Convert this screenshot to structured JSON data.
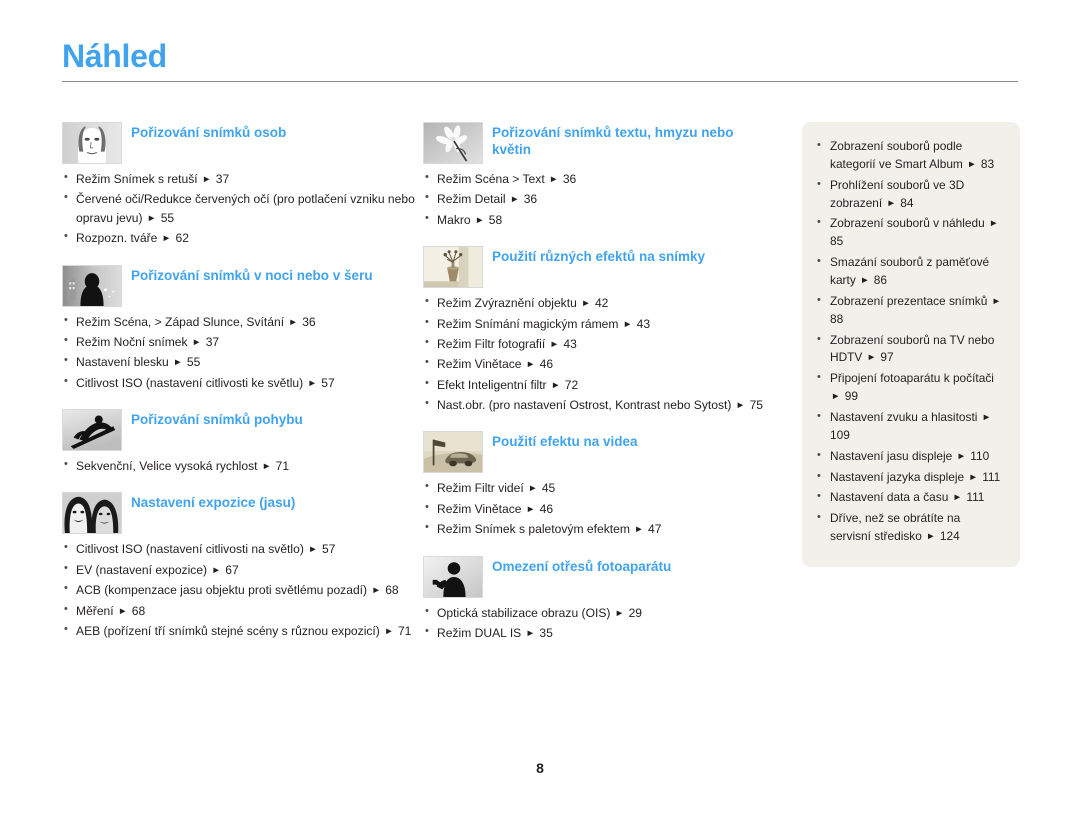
{
  "header": {
    "title": "Náhled"
  },
  "footer": {
    "page_number": "8"
  },
  "colors": {
    "accent": "#41a3ed",
    "text": "#231f20",
    "panel_bg": "#f2f0eb",
    "rule": "#8b8b8b"
  },
  "arrow_glyph": "►",
  "columns": {
    "left": [
      {
        "icon": "portrait-face-icon",
        "title": "Pořizování snímků osob",
        "items": [
          "Režim Snímek s retuší ► 37",
          "Červené oči/Redukce červených očí (pro potlačení vzniku nebo opravu jevu) ► 55",
          "Rozpozn. tváře ► 62"
        ]
      },
      {
        "icon": "night-silhouette-moon-icon",
        "title": "Pořizování snímků v noci nebo v šeru",
        "items": [
          "Režim Scéna, > Západ Slunce, Svítání ► 36",
          "Režim Noční snímek ► 37",
          "Nastavení blesku ► 55",
          "Citlivost ISO (nastavení citlivosti ke světlu) ► 57"
        ]
      },
      {
        "icon": "snowboarder-motion-icon",
        "title": "Pořizování snímků pohybu",
        "items": [
          "Sekvenční, Velice vysoká rychlost ► 71"
        ]
      },
      {
        "icon": "two-faces-exposure-icon",
        "title": "Nastavení expozice (jasu)",
        "items": [
          "Citlivost ISO (nastavení citlivosti na světlo) ► 57",
          "EV (nastavení expozice) ► 67",
          "ACB (kompenzace jasu objektu proti světlému pozadí) ► 68",
          "Měření ► 68",
          "AEB (pořízení tří snímků stejné scény s různou expozicí) ► 71"
        ]
      }
    ],
    "middle": [
      {
        "icon": "flower-macro-icon",
        "title": "Pořizování snímků textu, hmyzu nebo květin",
        "items": [
          "Režim Scéna > Text ► 36",
          "Režim Detail ► 36",
          "Makro ► 58"
        ]
      },
      {
        "icon": "vase-still-life-icon",
        "title": "Použití různých efektů na snímky",
        "items": [
          "Režim Zvýraznění objektu ► 42",
          "Režim Snímání magickým rámem ► 43",
          "Režim Filtr fotografií ► 43",
          "Režim Vinětace ► 46",
          "Efekt Inteligentní filtr ► 72",
          "Nast.obr. (pro nastavení Ostrost, Kontrast nebo Sytost) ► 75"
        ]
      },
      {
        "icon": "car-video-effect-icon",
        "title": "Použití efektu na videa",
        "items": [
          "Režim Filtr videí ► 45",
          "Režim Vinětace ► 46",
          "Režim Snímek s paletovým efektem ► 47"
        ]
      },
      {
        "icon": "steady-hand-shake-icon",
        "title": "Omezení otřesů fotoaparátu",
        "items": [
          "Optická stabilizace obrazu (OIS) ► 29",
          "Režim DUAL IS ► 35"
        ]
      }
    ],
    "right_panel": {
      "items": [
        "Zobrazení souborů podle kategorií ve Smart Album ► 83",
        "Prohlížení souborů ve 3D zobrazení ► 84",
        "Zobrazení souborů v náhledu ► 85",
        "Smazání souborů z paměťové karty ► 86",
        "Zobrazení prezentace snímků ► 88",
        "Zobrazení souborů na TV nebo HDTV ► 97",
        "Připojení fotoaparátu k počítači ► 99",
        "Nastavení zvuku a hlasitosti ► 109",
        "Nastavení jasu displeje ► 110",
        "Nastavení jazyka displeje ► 111",
        "Nastavení data a času ► 111",
        "Dříve, než se obrátíte na servisní středisko ► 124"
      ]
    }
  }
}
